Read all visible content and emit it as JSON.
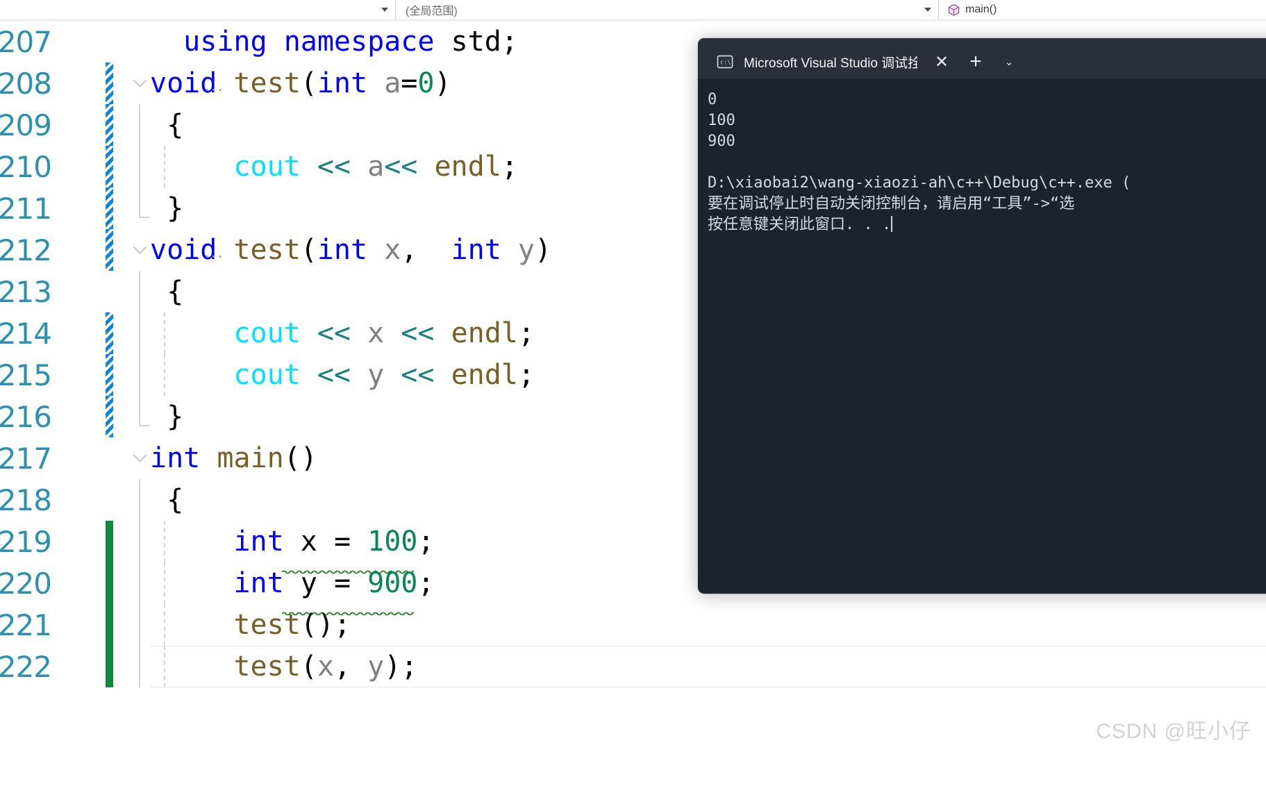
{
  "navbar": {
    "project_scope": {
      "value": "",
      "placeholder": "",
      "arrow_icon": "chevron-down-icon"
    },
    "global_scope": {
      "value": "(全局范围)",
      "arrow_icon": "chevron-down-icon"
    },
    "member_scope": {
      "value": "main()",
      "icon": "method-cube-icon"
    }
  },
  "editor": {
    "language": "C++",
    "first_line_number": 207,
    "current_line": 222,
    "lines": [
      {
        "number": "207",
        "marker": "none",
        "fold": "none",
        "indent_guide": false,
        "text": "  using namespace std;",
        "tokens": [
          {
            "t": "  ",
            "c": "plain"
          },
          {
            "t": "using",
            "c": "kw"
          },
          {
            "t": " ",
            "c": "plain"
          },
          {
            "t": "namespace",
            "c": "kw"
          },
          {
            "t": " ",
            "c": "plain"
          },
          {
            "t": "std",
            "c": "plain"
          },
          {
            "t": ";",
            "c": "plain"
          }
        ]
      },
      {
        "number": "208",
        "marker": "unsaved",
        "fold": "open",
        "indent_guide": false,
        "hint_dots": "...",
        "text": "void test(int a=0)",
        "tokens": [
          {
            "t": "void",
            "c": "kw"
          },
          {
            "t": " ",
            "c": "plain"
          },
          {
            "t": "test",
            "c": "fn"
          },
          {
            "t": "(",
            "c": "plain"
          },
          {
            "t": "int",
            "c": "kw"
          },
          {
            "t": " ",
            "c": "plain"
          },
          {
            "t": "a",
            "c": "var"
          },
          {
            "t": "=",
            "c": "op"
          },
          {
            "t": "0",
            "c": "num"
          },
          {
            "t": ")",
            "c": "plain"
          }
        ]
      },
      {
        "number": "209",
        "marker": "unsaved",
        "fold": "bar",
        "indent_guide": false,
        "text": " {",
        "tokens": [
          {
            "t": " {",
            "c": "plain"
          }
        ]
      },
      {
        "number": "210",
        "marker": "unsaved",
        "fold": "bar",
        "indent_guide": true,
        "text": "     cout << a<< endl;",
        "tokens": [
          {
            "t": "     ",
            "c": "plain"
          },
          {
            "t": "cout",
            "c": "cout"
          },
          {
            "t": " ",
            "c": "plain"
          },
          {
            "t": "<<",
            "c": "shift"
          },
          {
            "t": " ",
            "c": "plain"
          },
          {
            "t": "a",
            "c": "var"
          },
          {
            "t": "<<",
            "c": "shift"
          },
          {
            "t": " ",
            "c": "plain"
          },
          {
            "t": "endl",
            "c": "endl"
          },
          {
            "t": ";",
            "c": "plain"
          }
        ]
      },
      {
        "number": "211",
        "marker": "unsaved",
        "fold": "close",
        "indent_guide": false,
        "text": " }",
        "tokens": [
          {
            "t": " }",
            "c": "plain"
          }
        ]
      },
      {
        "number": "212",
        "marker": "unsaved",
        "fold": "open",
        "indent_guide": false,
        "hint_dots": "...",
        "text": "void test(int x,  int y)",
        "tokens": [
          {
            "t": "void",
            "c": "kw"
          },
          {
            "t": " ",
            "c": "plain"
          },
          {
            "t": "test",
            "c": "fn"
          },
          {
            "t": "(",
            "c": "plain"
          },
          {
            "t": "int",
            "c": "kw"
          },
          {
            "t": " ",
            "c": "plain"
          },
          {
            "t": "x",
            "c": "var"
          },
          {
            "t": ",",
            "c": "plain"
          },
          {
            "t": "  ",
            "c": "plain"
          },
          {
            "t": "int",
            "c": "kw"
          },
          {
            "t": " ",
            "c": "plain"
          },
          {
            "t": "y",
            "c": "var"
          },
          {
            "t": ")",
            "c": "plain"
          }
        ]
      },
      {
        "number": "213",
        "marker": "none",
        "fold": "bar",
        "indent_guide": false,
        "text": " {",
        "tokens": [
          {
            "t": " {",
            "c": "plain"
          }
        ]
      },
      {
        "number": "214",
        "marker": "unsaved",
        "fold": "bar",
        "indent_guide": true,
        "text": "     cout << x << endl;",
        "tokens": [
          {
            "t": "     ",
            "c": "plain"
          },
          {
            "t": "cout",
            "c": "cout"
          },
          {
            "t": " ",
            "c": "plain"
          },
          {
            "t": "<<",
            "c": "shift"
          },
          {
            "t": " ",
            "c": "plain"
          },
          {
            "t": "x",
            "c": "var"
          },
          {
            "t": " ",
            "c": "plain"
          },
          {
            "t": "<<",
            "c": "shift"
          },
          {
            "t": " ",
            "c": "plain"
          },
          {
            "t": "endl",
            "c": "endl"
          },
          {
            "t": ";",
            "c": "plain"
          }
        ]
      },
      {
        "number": "215",
        "marker": "unsaved",
        "fold": "bar",
        "indent_guide": true,
        "text": "     cout << y << endl;",
        "tokens": [
          {
            "t": "     ",
            "c": "plain"
          },
          {
            "t": "cout",
            "c": "cout"
          },
          {
            "t": " ",
            "c": "plain"
          },
          {
            "t": "<<",
            "c": "shift"
          },
          {
            "t": " ",
            "c": "plain"
          },
          {
            "t": "y",
            "c": "var"
          },
          {
            "t": " ",
            "c": "plain"
          },
          {
            "t": "<<",
            "c": "shift"
          },
          {
            "t": " ",
            "c": "plain"
          },
          {
            "t": "endl",
            "c": "endl"
          },
          {
            "t": ";",
            "c": "plain"
          }
        ]
      },
      {
        "number": "216",
        "marker": "unsaved",
        "fold": "close",
        "indent_guide": false,
        "text": " }",
        "tokens": [
          {
            "t": " }",
            "c": "plain"
          }
        ]
      },
      {
        "number": "217",
        "marker": "none",
        "fold": "open",
        "indent_guide": false,
        "text": "int main()",
        "tokens": [
          {
            "t": "int",
            "c": "kw"
          },
          {
            "t": " ",
            "c": "plain"
          },
          {
            "t": "main",
            "c": "fn"
          },
          {
            "t": "()",
            "c": "plain"
          }
        ]
      },
      {
        "number": "218",
        "marker": "none",
        "fold": "bar",
        "indent_guide": false,
        "text": " {",
        "tokens": [
          {
            "t": " {",
            "c": "plain"
          }
        ]
      },
      {
        "number": "219",
        "marker": "saved",
        "fold": "bar",
        "indent_guide": true,
        "squiggle": {
          "color": "#1a7a1a",
          "start": 190,
          "width": 190
        },
        "text": "     int x = 100;",
        "tokens": [
          {
            "t": "     ",
            "c": "plain"
          },
          {
            "t": "int",
            "c": "kw"
          },
          {
            "t": " ",
            "c": "plain"
          },
          {
            "t": "x",
            "c": "plain"
          },
          {
            "t": " ",
            "c": "plain"
          },
          {
            "t": "=",
            "c": "op"
          },
          {
            "t": " ",
            "c": "plain"
          },
          {
            "t": "100",
            "c": "num"
          },
          {
            "t": ";",
            "c": "plain"
          }
        ]
      },
      {
        "number": "220",
        "marker": "saved",
        "fold": "bar",
        "indent_guide": true,
        "squiggle": {
          "color": "#1a7a1a",
          "start": 190,
          "width": 190
        },
        "text": "     int y = 900;",
        "tokens": [
          {
            "t": "     ",
            "c": "plain"
          },
          {
            "t": "int",
            "c": "kw"
          },
          {
            "t": " ",
            "c": "plain"
          },
          {
            "t": "y",
            "c": "plain"
          },
          {
            "t": " ",
            "c": "plain"
          },
          {
            "t": "=",
            "c": "op"
          },
          {
            "t": " ",
            "c": "plain"
          },
          {
            "t": "900",
            "c": "num"
          },
          {
            "t": ";",
            "c": "plain"
          }
        ]
      },
      {
        "number": "221",
        "marker": "saved",
        "fold": "bar",
        "indent_guide": true,
        "text": "     test();",
        "tokens": [
          {
            "t": "     ",
            "c": "plain"
          },
          {
            "t": "test",
            "c": "fn"
          },
          {
            "t": "();",
            "c": "plain"
          }
        ]
      },
      {
        "number": "222",
        "marker": "saved",
        "fold": "bar",
        "indent_guide": true,
        "highlighted": true,
        "text": "     test(x, y);",
        "tokens": [
          {
            "t": "     ",
            "c": "plain"
          },
          {
            "t": "test",
            "c": "fn"
          },
          {
            "t": "(",
            "c": "plain"
          },
          {
            "t": "x",
            "c": "var"
          },
          {
            "t": ",",
            "c": "plain"
          },
          {
            "t": " ",
            "c": "plain"
          },
          {
            "t": "y",
            "c": "var"
          },
          {
            "t": ");",
            "c": "plain"
          }
        ]
      }
    ]
  },
  "console": {
    "tab": {
      "icon": "console-cmd-icon",
      "title": "Microsoft Visual Studio 调试拴",
      "close_label": "✕",
      "new_tab_label": "+",
      "dropdown_label": "⌄"
    },
    "output_lines": [
      "0",
      "100",
      "900",
      "",
      "D:\\xiaobai2\\wang-xiaozi-ah\\c++\\Debug\\c++.exe (",
      "要在调试停止时自动关闭控制台，请启用“工具”->“选",
      "按任意键关闭此窗口. . ."
    ]
  },
  "watermark": {
    "text": "CSDN @旺小仔"
  },
  "colors": {
    "keyword_blue": "#0000ff",
    "function_brown": "#795e26",
    "cout_cyan": "#00e0ff",
    "shift_teal": "#1a7f7f",
    "number_green": "#098658",
    "variable_gray": "#808080",
    "line_number_teal": "#2b91af",
    "unsaved_marker_blue": "#0a84d8",
    "saved_marker_green": "#10893e",
    "squiggle_green": "#1a7a1a",
    "console_bg": "#1e222a",
    "console_tabstrip": "#2b2f38",
    "console_text": "#d6dae0"
  }
}
